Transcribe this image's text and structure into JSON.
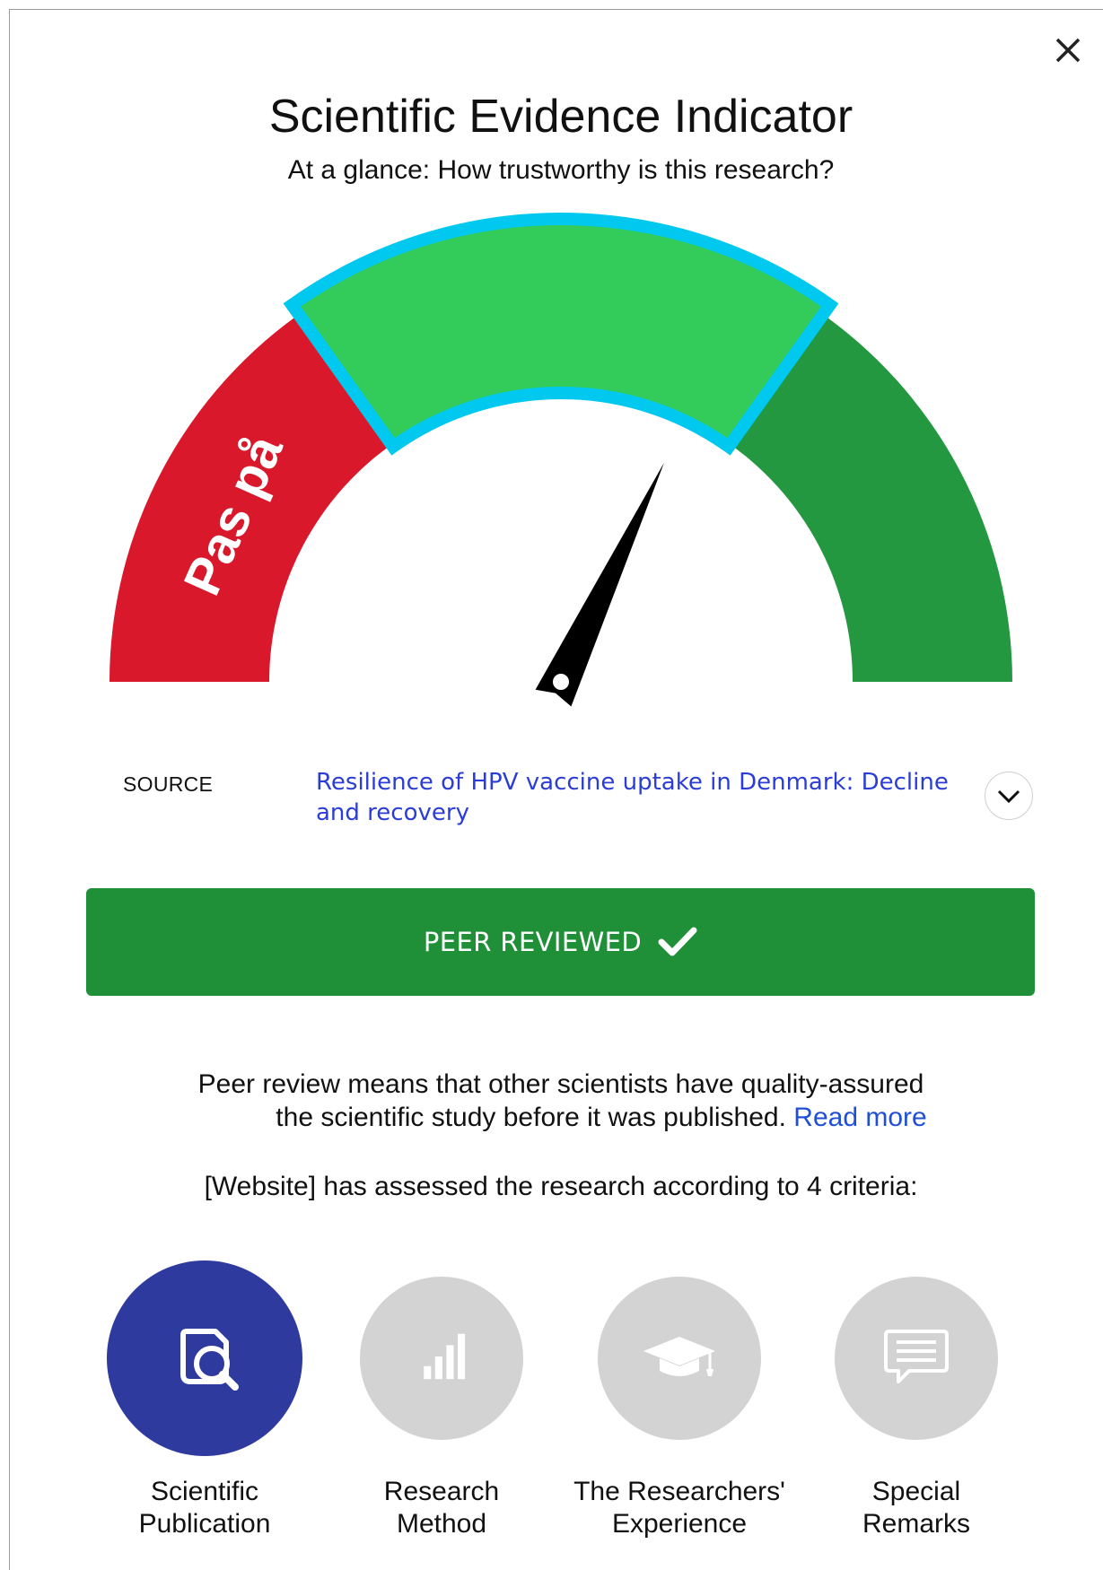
{
  "dialog": {
    "title": "Scientific Evidence Indicator",
    "subtitle": "At a glance: How trustworthy is this research?"
  },
  "gauge": {
    "left_zone_label": "Pas på",
    "colors": {
      "left": "#d9192b",
      "middle": "#33cc5a",
      "middle_outline": "#00c8ee",
      "right": "#239840",
      "needle": "#000000"
    },
    "selected_zone": "middle",
    "needle_level": 0.64
  },
  "source": {
    "label": "SOURCE",
    "title": "Resilience of HPV vaccine uptake in Denmark: Decline and recovery"
  },
  "status": {
    "label": "PEER REVIEWED",
    "color": "#1f9038"
  },
  "description": {
    "line1": "Peer review means that other scientists have quality-assured",
    "line2": "the scientific study before it was published.",
    "read_more": "Read more"
  },
  "criteria_intro": "[Website] has assessed the research according to 4 criteria:",
  "criteria": [
    {
      "line1": "Scientific",
      "line2": "Publication",
      "icon": "document-search-icon",
      "active": true
    },
    {
      "line1": "Research",
      "line2": "Method",
      "icon": "bar-chart-icon",
      "active": false
    },
    {
      "line1": "The Researchers'",
      "line2": "Experience",
      "icon": "graduation-cap-icon",
      "active": false
    },
    {
      "line1": "Special",
      "line2": "Remarks",
      "icon": "speech-bubble-icon",
      "active": false
    }
  ],
  "criteria_colors": {
    "active": "#2f3a9f",
    "inactive": "#d3d3d3"
  }
}
